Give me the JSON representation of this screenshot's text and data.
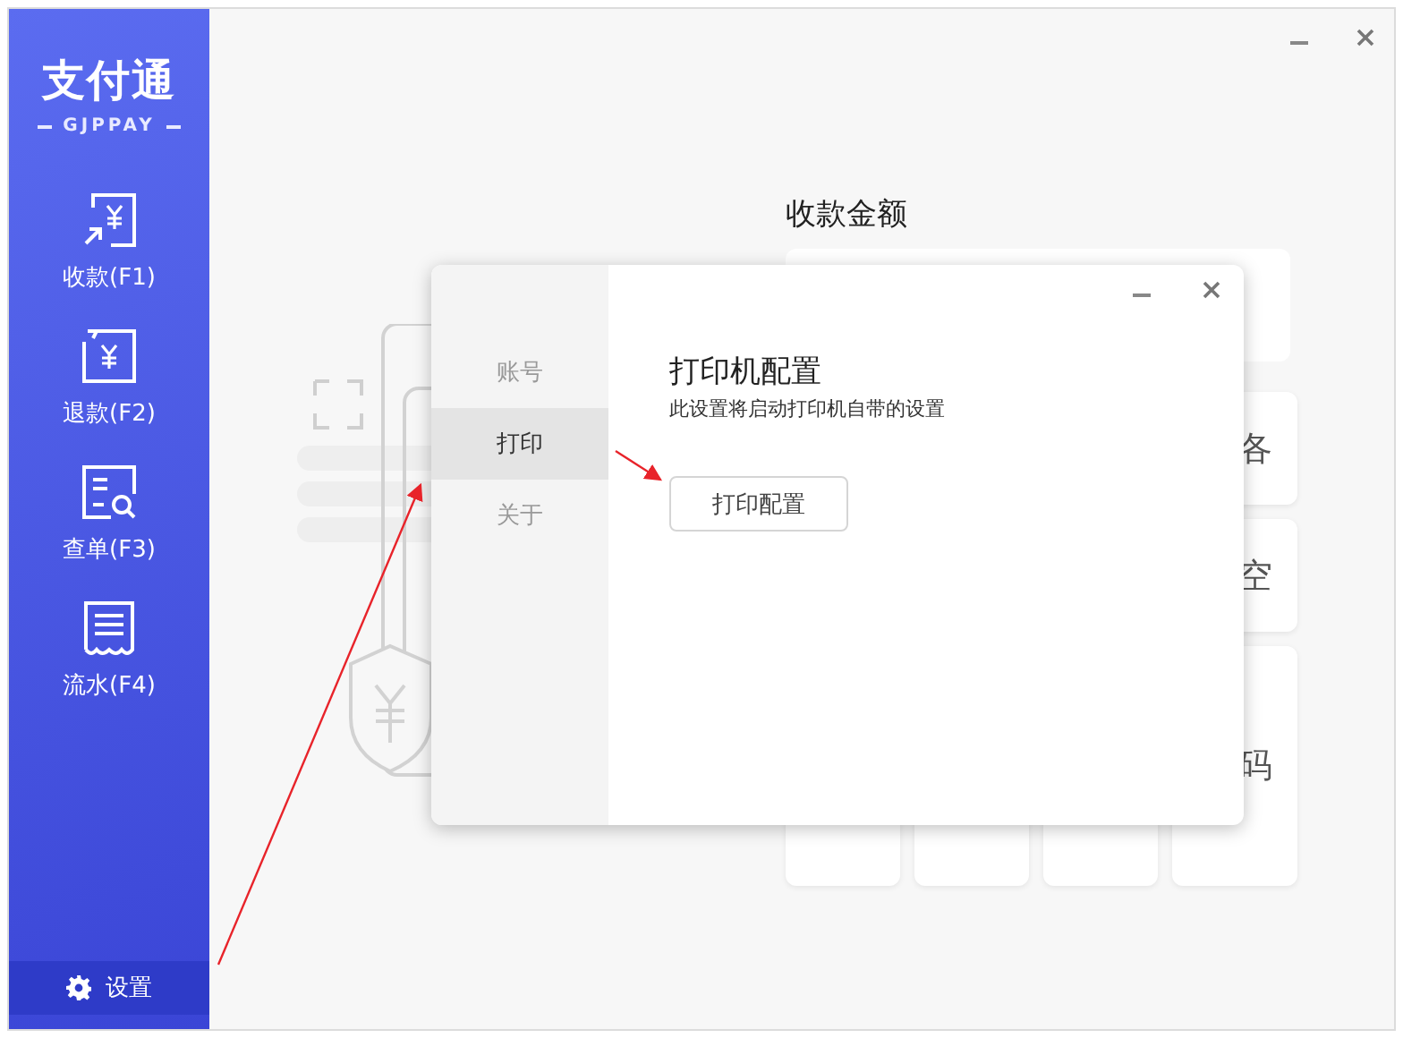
{
  "sidebar": {
    "logo": "支付通",
    "logo_sub": "GJPPAY",
    "items": [
      {
        "kind": "receive",
        "label": "收款(F1)"
      },
      {
        "kind": "refund",
        "label": "退款(F2)"
      },
      {
        "kind": "query",
        "label": "查单(F3)"
      },
      {
        "kind": "ledger",
        "label": "流水(F4)"
      }
    ],
    "settings": "设置"
  },
  "payment": {
    "title": "收款金额",
    "side_buttons": [
      "各",
      "空",
      "码"
    ]
  },
  "dialog": {
    "tabs": [
      {
        "label": "账号",
        "selected": false
      },
      {
        "label": "打印",
        "selected": true
      },
      {
        "label": "关于",
        "selected": false
      }
    ],
    "title": "打印机配置",
    "subtitle": "此设置将启动打印机自带的设置",
    "button": "打印配置"
  }
}
